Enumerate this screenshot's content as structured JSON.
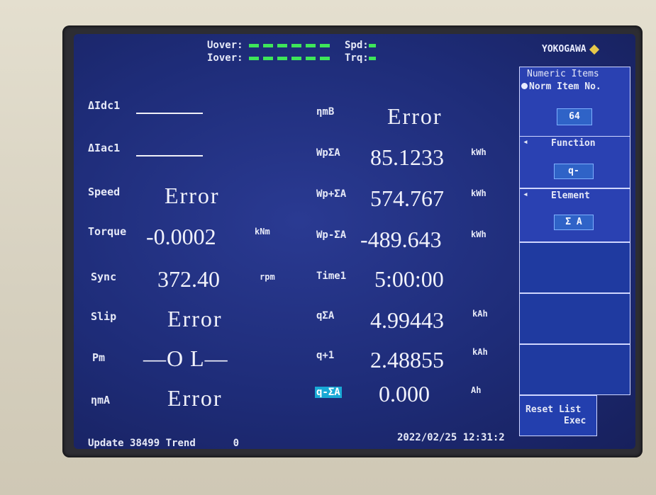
{
  "header": {
    "uover_label": "Uover:",
    "iover_label": "Iover:",
    "spd_label": "Spd:",
    "trq_label": "Trq:"
  },
  "brand": "YOKOGAWA",
  "right_panel": {
    "title": "Numeric Items",
    "norm_item_label": "Norm Item No.",
    "norm_item_value": "64",
    "function_label": "Function",
    "function_value": "q-",
    "element_label": "Element",
    "element_value": "Σ A",
    "reset_label": "Reset List",
    "exec_label": "Exec"
  },
  "left_items": [
    {
      "label": "ΔIdc1",
      "value": "",
      "unit": ""
    },
    {
      "label": "ΔIac1",
      "value": "",
      "unit": ""
    },
    {
      "label": "Speed",
      "value": "Error",
      "unit": ""
    },
    {
      "label": "Torque",
      "value": "-0.0002",
      "unit": "kNm"
    },
    {
      "label": "Sync",
      "value": "372.40",
      "unit": "rpm"
    },
    {
      "label": "Slip",
      "value": "Error",
      "unit": ""
    },
    {
      "label": "Pm",
      "value": "—O L—",
      "unit": ""
    },
    {
      "label": "ηmA",
      "value": "Error",
      "unit": ""
    }
  ],
  "right_items": [
    {
      "label": "ηmB",
      "value": "Error",
      "unit": ""
    },
    {
      "label": "WpΣA",
      "value": "85.1233",
      "unit": "kWh"
    },
    {
      "label": "Wp+ΣA",
      "value": "574.767",
      "unit": "kWh"
    },
    {
      "label": "Wp-ΣA",
      "value": "-489.643",
      "unit": "kWh"
    },
    {
      "label": "Time1",
      "value": "5:00:00",
      "unit": ""
    },
    {
      "label": "qΣA",
      "value": "4.99443",
      "unit": "kAh"
    },
    {
      "label": "q+1",
      "value": "2.48855",
      "unit": "kAh"
    },
    {
      "label": "q-ΣA",
      "value": "0.000",
      "unit": "Ah"
    }
  ],
  "status": {
    "update_label": "Update",
    "update_count": "38499",
    "trend_label": "Trend",
    "trend_value": "0",
    "datetime": "2022/02/25 12:31:2"
  }
}
